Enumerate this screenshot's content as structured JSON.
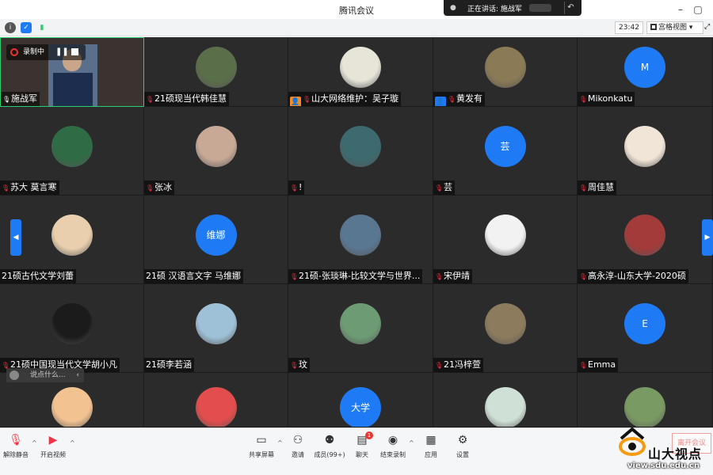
{
  "app": {
    "title": "腾讯会议"
  },
  "speaking": {
    "label": "正在讲话: 施战军"
  },
  "infobar": {
    "time": "23:42",
    "view": "宫格视图"
  },
  "recording": {
    "label": "录制中"
  },
  "tiles": [
    {
      "name": "施战军",
      "kind": "video",
      "mic": "on"
    },
    {
      "name": "21硕现当代韩佳慧",
      "kind": "photo",
      "mic": "muted",
      "color": "#5b6e4a"
    },
    {
      "name": "山大网络维护：吴子璇",
      "kind": "photo",
      "mic": "muted",
      "role": "host",
      "color": "#e7e4d8"
    },
    {
      "name": "黄发有",
      "kind": "photo",
      "mic": "muted",
      "role": "user",
      "color": "#8a7a56"
    },
    {
      "name": "Mikonkatu",
      "kind": "letter",
      "letter": "M",
      "mic": "muted"
    },
    {
      "name": "苏大 莫言寒",
      "kind": "photo",
      "mic": "muted",
      "color": "#2f6b45"
    },
    {
      "name": "张冰",
      "kind": "photo",
      "mic": "muted",
      "color": "#c8a996"
    },
    {
      "name": "!",
      "kind": "photo",
      "mic": "muted",
      "color": "#3c6a6e"
    },
    {
      "name": "芸",
      "kind": "letter",
      "letter": "芸",
      "mic": "muted"
    },
    {
      "name": "周佳慧",
      "kind": "photo",
      "mic": "muted",
      "color": "#f1e5d7"
    },
    {
      "name": "21硕古代文学刘蕾",
      "kind": "photo",
      "mic": "none",
      "color": "#e9cfae"
    },
    {
      "name": "21硕 汉语言文字 马维娜",
      "kind": "letter",
      "letter": "维娜",
      "mic": "none"
    },
    {
      "name": "21硕-张琰琳-比较文学与世界...",
      "kind": "photo",
      "mic": "muted",
      "color": "#5a7791"
    },
    {
      "name": "宋伊靖",
      "kind": "photo",
      "mic": "muted",
      "color": "#f2f2f2"
    },
    {
      "name": "高永淳-山东大学-2020硕",
      "kind": "photo",
      "mic": "muted",
      "color": "#a33b3b"
    },
    {
      "name": "21硕中国现当代文学胡小凡",
      "kind": "photo",
      "mic": "muted",
      "color": "#1b1b1b"
    },
    {
      "name": "21硕李若涵",
      "kind": "photo",
      "mic": "none",
      "color": "#9fc1d8"
    },
    {
      "name": "玟",
      "kind": "photo",
      "mic": "muted",
      "color": "#6d9c74"
    },
    {
      "name": "21冯梓萱",
      "kind": "photo",
      "mic": "muted",
      "color": "#8d7b5e"
    },
    {
      "name": "Emma",
      "kind": "letter",
      "letter": "E",
      "mic": "muted"
    },
    {
      "name": "",
      "kind": "photo",
      "mic": "none",
      "color": "#f3c291"
    },
    {
      "name": "",
      "kind": "photo",
      "mic": "none",
      "color": "#e34d4d"
    },
    {
      "name": "",
      "kind": "letter",
      "letter": "大学",
      "mic": "none"
    },
    {
      "name": "",
      "kind": "photo",
      "mic": "none",
      "color": "#cfe0d6"
    },
    {
      "name": "",
      "kind": "photo",
      "mic": "none",
      "color": "#7a9a63"
    }
  ],
  "chat": {
    "placeholder": "说点什么..."
  },
  "toolbar": {
    "unmute": "解除静音",
    "video": "开启视频",
    "share": "共享屏幕",
    "invite": "邀请",
    "members": "成员(99+)",
    "chat": "聊天",
    "stop_record": "结束录制",
    "apps": "应用",
    "settings": "设置",
    "chat_badge": "1"
  },
  "watermark": {
    "brand": "山大视点",
    "url": "view.sdu.edu.cn",
    "leave": "离开会议"
  },
  "colors": {
    "accent": "#1f7bf5",
    "muted": "#e34",
    "active_border": "#2ecc71"
  }
}
